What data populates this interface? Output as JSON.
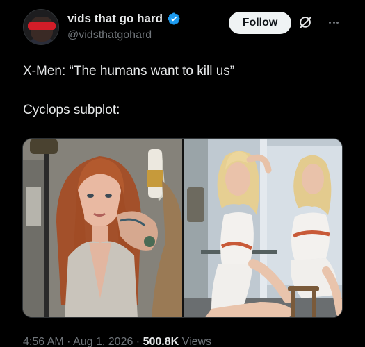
{
  "author": {
    "display_name": "vids that go hard",
    "handle": "@vidsthatgohard",
    "verified": true,
    "verified_color": "#1d9bf0"
  },
  "header": {
    "follow_label": "Follow"
  },
  "tweet": {
    "line1": "X-Men: “The humans want to kill us”",
    "line2": "Cyclops subplot:"
  },
  "footer": {
    "time": "4:56 AM",
    "date": "Aug 1, 2026",
    "views_count": "500.8K",
    "views_label": "Views",
    "separator": "·"
  },
  "colors": {
    "background": "#000000",
    "text": "#e7e9ea",
    "muted": "#71767b",
    "follow_bg": "#eff3f4"
  }
}
